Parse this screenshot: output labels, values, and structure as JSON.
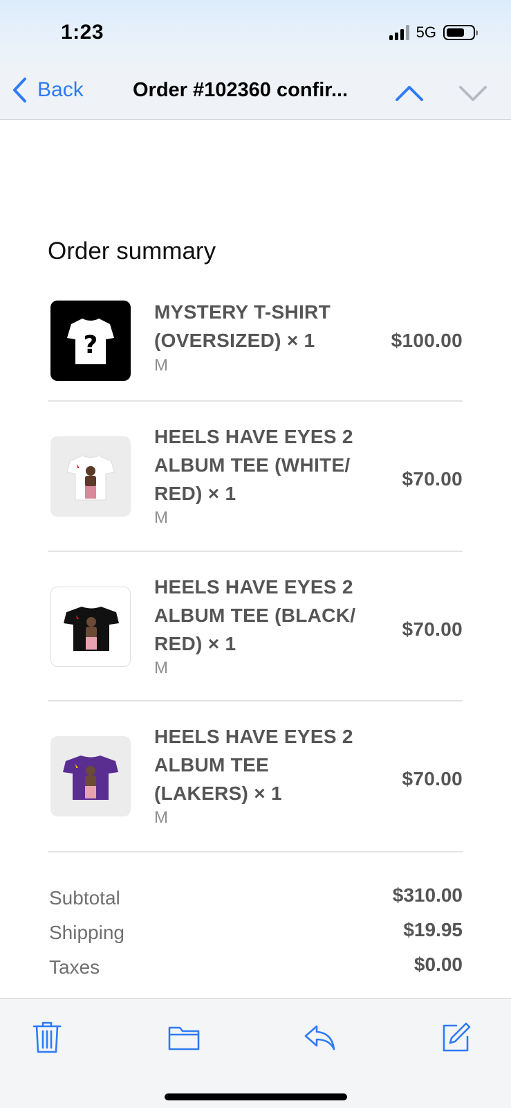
{
  "status_bar": {
    "time": "1:23",
    "network": "5G",
    "battery_fraction": 0.7
  },
  "nav": {
    "back_label": "Back",
    "title": "Order #102360 confir...",
    "accent_color": "#2f7bf5"
  },
  "content": {
    "summary_title": "Order summary",
    "items": [
      {
        "title": "MYSTERY T-SHIRT (OVERSIZED) × 1",
        "variant": "M",
        "price": "$100.00",
        "thumbnail_icon": "mystery-tshirt-icon"
      },
      {
        "title": "HEELS HAVE EYES 2 ALBUM TEE (WHITE/ RED) × 1",
        "variant": "M",
        "price": "$70.00",
        "thumbnail_icon": "white-tee-icon"
      },
      {
        "title": "HEELS HAVE EYES 2 ALBUM TEE (BLACK/ RED) × 1",
        "variant": "M",
        "price": "$70.00",
        "thumbnail_icon": "black-tee-icon"
      },
      {
        "title": "HEELS HAVE EYES 2 ALBUM TEE (LAKERS) × 1",
        "variant": "M",
        "price": "$70.00",
        "thumbnail_icon": "purple-tee-icon"
      }
    ],
    "totals": [
      {
        "label": "Subtotal",
        "value": "$310.00"
      },
      {
        "label": "Shipping",
        "value": "$19.95"
      },
      {
        "label": "Taxes",
        "value": "$0.00"
      }
    ]
  },
  "toolbar": {
    "icons": [
      "trash-icon",
      "folder-icon",
      "reply-icon",
      "compose-icon"
    ]
  }
}
